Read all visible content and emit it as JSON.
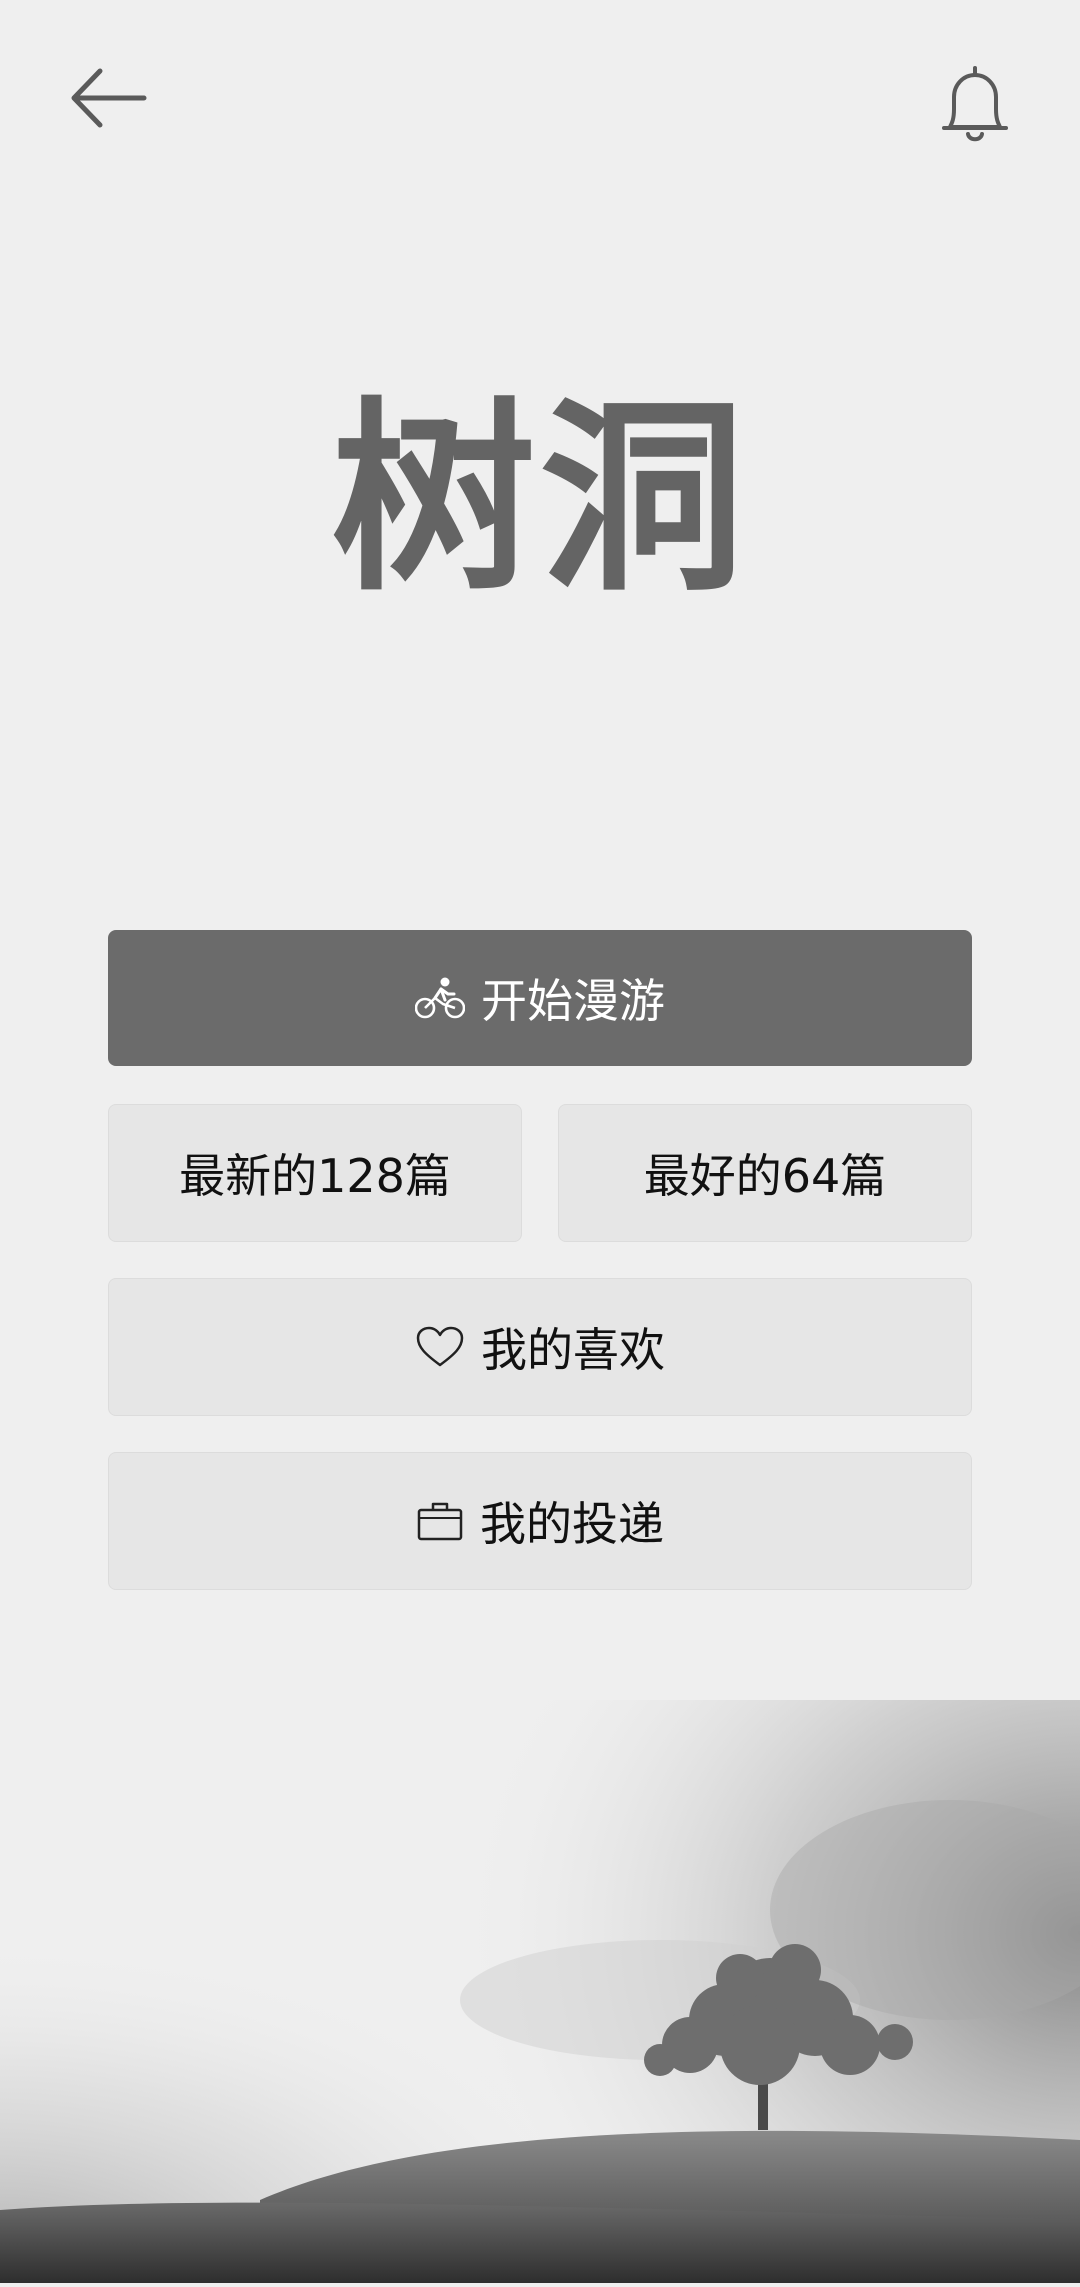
{
  "header": {
    "back_icon": "arrow-left-icon",
    "notification_icon": "bell-icon"
  },
  "title": "树洞",
  "actions": {
    "roam": {
      "label": "开始漫游",
      "icon": "bicycle-rider-icon"
    },
    "latest": {
      "label": "最新的128篇"
    },
    "best": {
      "label": "最好的64篇"
    },
    "likes": {
      "label": "我的喜欢",
      "icon": "heart-icon"
    },
    "posts": {
      "label": "我的投递",
      "icon": "briefcase-icon"
    }
  },
  "background": {
    "illustration": "foggy-hill-with-tree"
  },
  "colors": {
    "background": "#efefef",
    "primary_button": "#6b6b6b",
    "secondary_button": "#e6e6e6",
    "title": "#646464"
  }
}
